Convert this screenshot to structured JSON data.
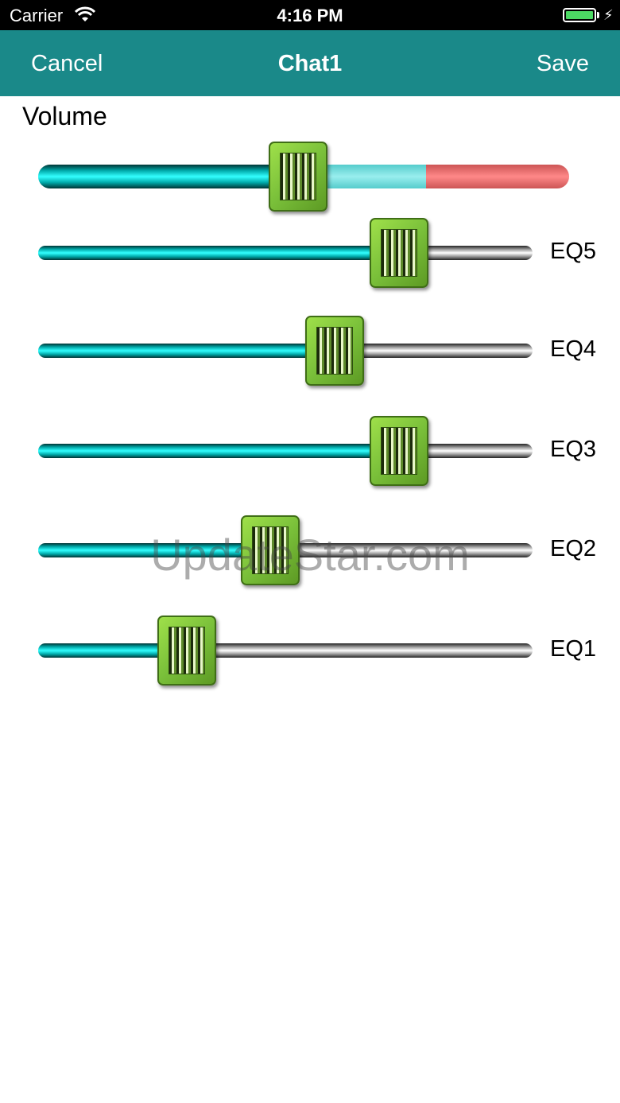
{
  "status_bar": {
    "carrier": "Carrier",
    "time": "4:16 PM"
  },
  "nav": {
    "cancel_label": "Cancel",
    "title": "Chat1",
    "save_label": "Save"
  },
  "volume": {
    "label": "Volume",
    "value": 0.49,
    "buffered": 0.73
  },
  "equalizers": [
    {
      "label": "EQ5",
      "value": 0.73
    },
    {
      "label": "EQ4",
      "value": 0.6
    },
    {
      "label": "EQ3",
      "value": 0.73
    },
    {
      "label": "EQ2",
      "value": 0.47
    },
    {
      "label": "EQ1",
      "value": 0.3
    }
  ],
  "watermark": "UpdateStar.com",
  "colors": {
    "nav_bar": "#1a8989",
    "thumb": "#7ac03a",
    "track_fill": "#00bfbf",
    "volume_peak": "#e07070"
  }
}
